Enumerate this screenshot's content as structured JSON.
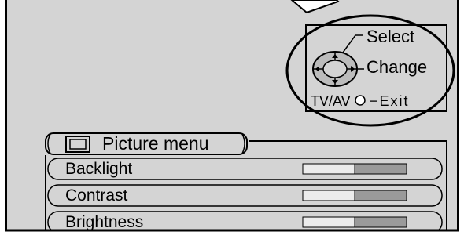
{
  "remote_hint": {
    "select_label": "Select",
    "change_label": "Change",
    "tvav_label": "TV/AV",
    "exit_label": "Exit",
    "connector": "−"
  },
  "menu": {
    "title": "Picture menu",
    "items": [
      {
        "label": "Backlight",
        "level": 0.5
      },
      {
        "label": "Contrast",
        "level": 0.5
      },
      {
        "label": "Brightness",
        "level": 0.5
      }
    ]
  },
  "colors": {
    "screen_bg": "#d4d4d4",
    "bar_fill": "#ececec",
    "bar_rest": "#9a9a9a"
  }
}
